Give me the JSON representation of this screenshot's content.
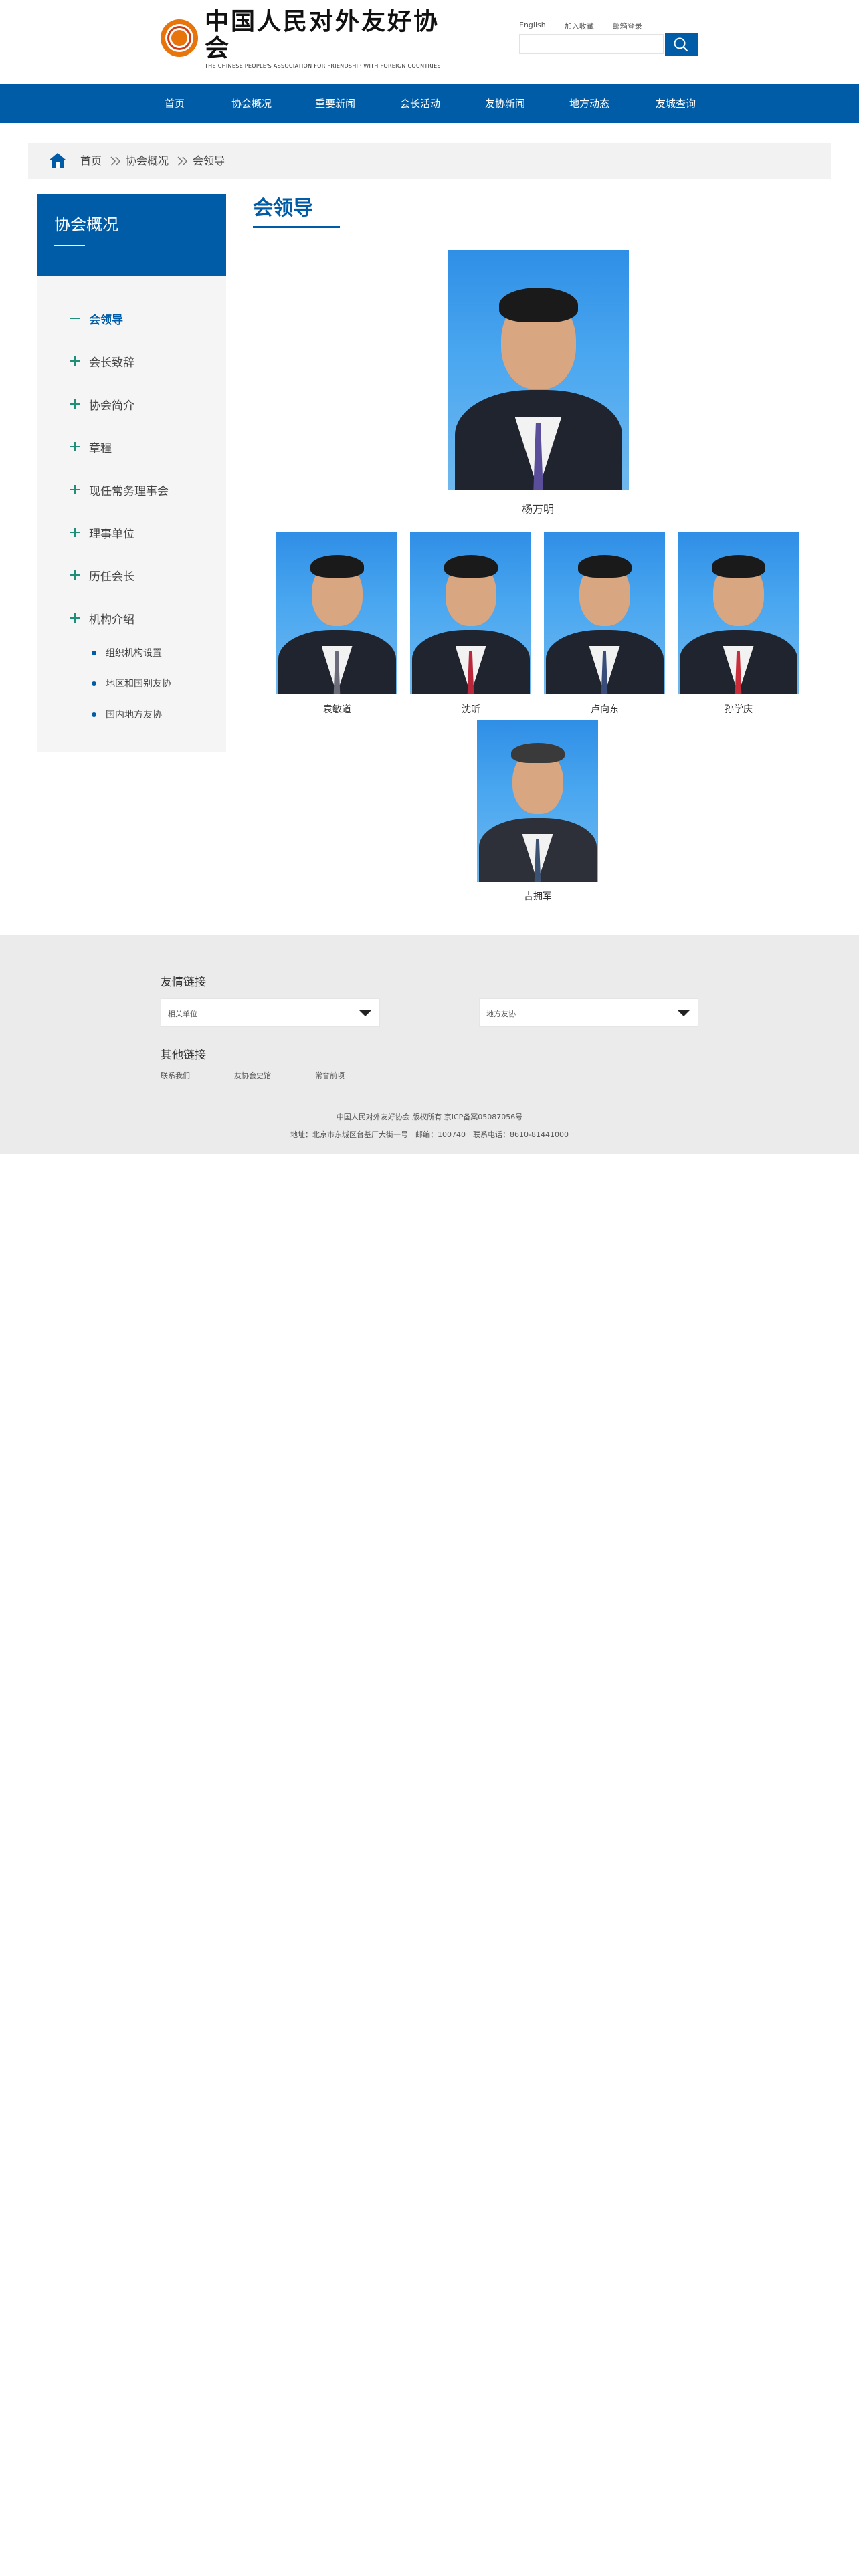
{
  "header": {
    "logo_cn": "中国人民对外友好协会",
    "logo_en": "THE CHINESE PEOPLE'S ASSOCIATION FOR FRIENDSHIP WITH FOREIGN COUNTRIES",
    "top_links": [
      "English",
      "加入收藏",
      "邮箱登录"
    ],
    "search_placeholder": ""
  },
  "nav": [
    "首页",
    "协会概况",
    "重要新闻",
    "会长活动",
    "友协新闻",
    "地方动态",
    "友城查询"
  ],
  "breadcrumb": [
    "首页",
    "协会概况",
    "会领导"
  ],
  "sidebar": {
    "title": "协会概况",
    "items": [
      {
        "label": "会领导",
        "active": true
      },
      {
        "label": "会长致辞"
      },
      {
        "label": "协会简介"
      },
      {
        "label": "章程"
      },
      {
        "label": "现任常务理事会"
      },
      {
        "label": "理事单位"
      },
      {
        "label": "历任会长"
      },
      {
        "label": "机构介绍"
      }
    ],
    "sub_items": [
      "组织机构设置",
      "地区和国别友协",
      "国内地方友协"
    ]
  },
  "main": {
    "title": "会领导",
    "leaders": [
      "杨万明",
      "袁敏道",
      "沈昕",
      "卢向东",
      "孙学庆",
      "吉拥军"
    ]
  },
  "footer": {
    "friend_links_title": "友情链接",
    "select_1": "相关单位",
    "select_2": "地方友协",
    "other_links_title": "其他链接",
    "other_links": [
      "联系我们",
      "友协会史馆",
      "常誉前项"
    ],
    "copyright": "中国人民对外友好协会 版权所有 京ICP备案05087056号",
    "address": "地址：北京市东城区台基厂大街一号　邮编：100740　联系电话：8610-81441000"
  },
  "colors": {
    "brand_blue": "#005ca6",
    "footer_bg": "#ebebeb",
    "sidebar_bg": "#f5f5f5",
    "icon_green": "#1f8f7a"
  },
  "icons": {
    "search": "search-icon",
    "home": "home-icon",
    "breadcrumb_sep": "double-chevron-right-icon",
    "tree_plus": "plus-icon",
    "tree_minus": "minus-icon",
    "select_caret": "caret-down-icon"
  }
}
